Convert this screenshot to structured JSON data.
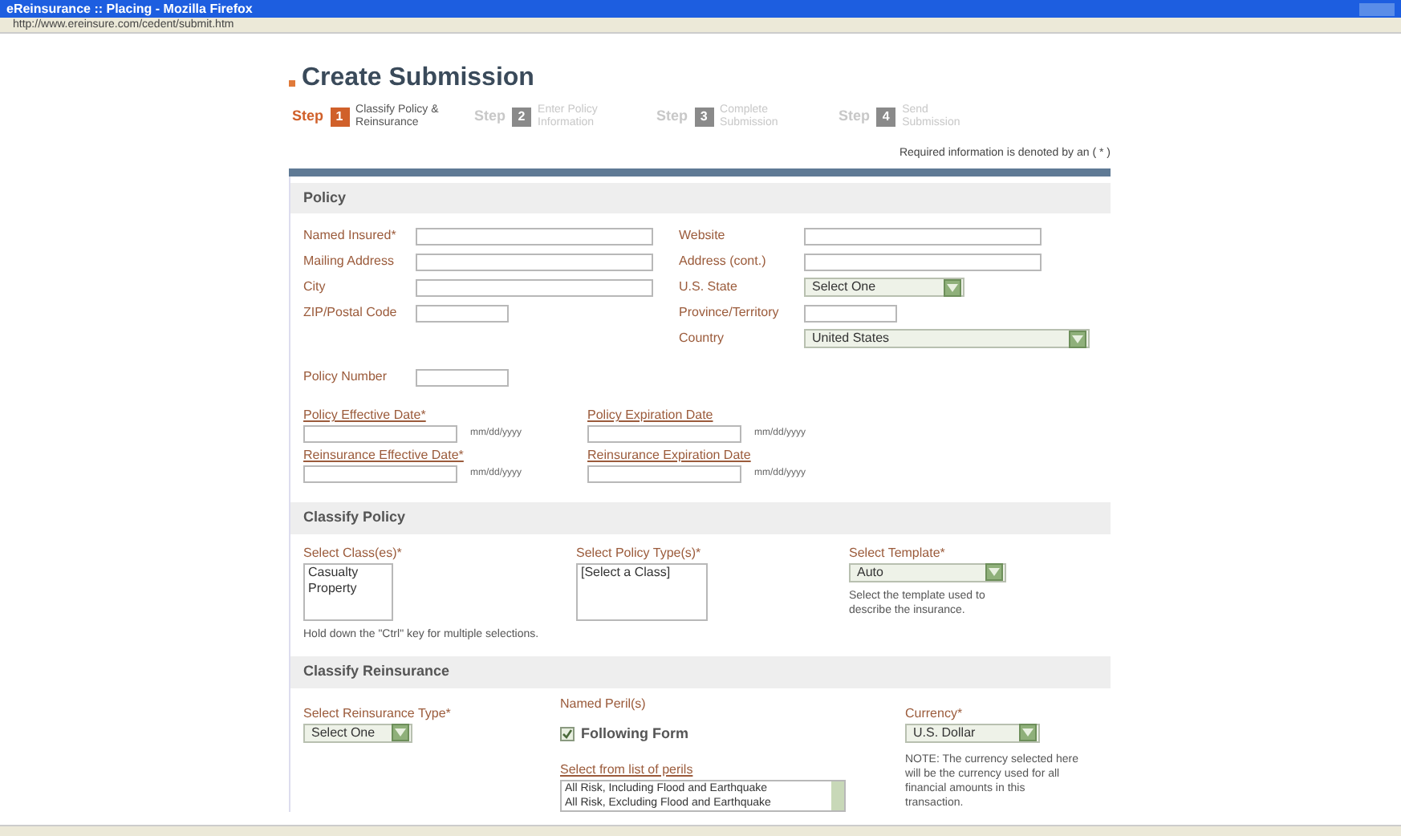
{
  "window": {
    "title": "eReinsurance :: Placing - Mozilla Firefox"
  },
  "address_bar": {
    "url": "http://www.ereinsure.com/cedent/submit.htm"
  },
  "page": {
    "title": "Create Submission",
    "required_note": "Required information is denoted by an ( * )"
  },
  "steps": [
    {
      "label": "Step",
      "number": "1",
      "text": "Classify Policy & Reinsurance",
      "selected": true
    },
    {
      "label": "Step",
      "number": "2",
      "text": "Enter Policy Information",
      "selected": false
    },
    {
      "label": "Step",
      "number": "3",
      "text": "Complete Submission",
      "selected": false
    },
    {
      "label": "Step",
      "number": "4",
      "text": "Send Submission",
      "selected": false
    }
  ],
  "policy": {
    "title": "Policy",
    "left_fields": [
      {
        "kind": "text",
        "label": "Named Insured*"
      },
      {
        "kind": "text",
        "label": "Mailing Address"
      },
      {
        "kind": "text",
        "label": "City"
      },
      {
        "kind": "shorttext",
        "label": "ZIP/Postal Code"
      }
    ],
    "right_fields": [
      {
        "kind": "text",
        "label": "Website"
      },
      {
        "kind": "text",
        "label": "Address (cont.)"
      },
      {
        "kind": "shortselect",
        "label": "U.S. State",
        "value": "Select One"
      },
      {
        "kind": "shorttext",
        "label": "Province/Territory"
      },
      {
        "kind": "select",
        "label": "Country",
        "value": "United States"
      }
    ],
    "policy_number": {
      "label": "Policy Number"
    },
    "dates": [
      {
        "label": "Policy Effective Date*",
        "hint": "mm/dd/yyyy"
      },
      {
        "label": "Policy Expiration Date",
        "hint": "mm/dd/yyyy"
      },
      {
        "label": "Reinsurance Effective Date*",
        "hint": "mm/dd/yyyy"
      },
      {
        "label": "Reinsurance Expiration Date",
        "hint": "mm/dd/yyyy"
      }
    ]
  },
  "classify_policy": {
    "title": "Classify Policy",
    "classes": {
      "label": "Select Class(es)*",
      "options": [
        "Casualty",
        "Property"
      ]
    },
    "policy_types": {
      "label": "Select Policy Type(s)*",
      "options": [
        "[Select a Class]"
      ]
    },
    "template": {
      "label": "Select Template*",
      "value": "Auto",
      "note": "Select the template used to describe the insurance."
    },
    "note": "Hold down the \"Ctrl\" key for multiple selections."
  },
  "classify_reinsurance": {
    "title": "Classify Reinsurance",
    "type": {
      "label": "Select Reinsurance Type*",
      "value": "Select One"
    },
    "perils": {
      "label": "Named Peril(s)",
      "checkbox": {
        "label": "Following Form",
        "checked": true
      },
      "list_label": "Select from list of perils",
      "options": [
        "All Risk, Including Flood and Earthquake",
        "All Risk, Excluding Flood and Earthquake"
      ]
    },
    "currency": {
      "label": "Currency*",
      "value": "U.S. Dollar",
      "note": "NOTE: The currency selected here will be the currency used for all financial amounts in this transaction."
    }
  }
}
